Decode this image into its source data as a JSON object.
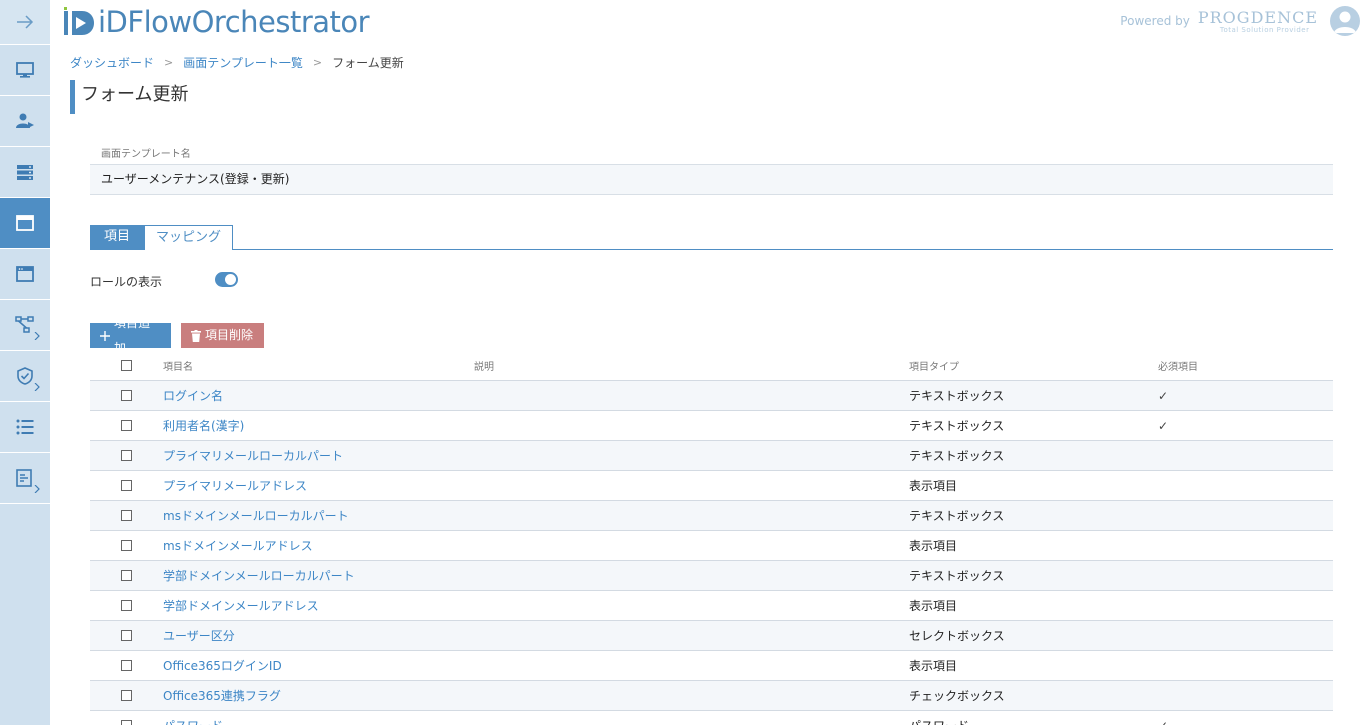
{
  "app": {
    "logo_text": "iDFlowOrchestrator",
    "powered_label": "Powered by",
    "brand_name": "PROGDENCE",
    "brand_tag": "Total Solution Provider"
  },
  "breadcrumb": {
    "items": [
      "ダッシュボード",
      "画面テンプレート一覧"
    ],
    "current": "フォーム更新"
  },
  "page": {
    "title": "フォーム更新"
  },
  "template_field": {
    "label": "画面テンプレート名",
    "value": "ユーザーメンテナンス(登録・更新)"
  },
  "tabs": [
    {
      "label": "項目",
      "active": true
    },
    {
      "label": "マッピング",
      "active": false
    }
  ],
  "role_toggle": {
    "label": "ロールの表示",
    "on": true
  },
  "actions": {
    "add_label": "項目追加",
    "delete_label": "項目削除"
  },
  "table": {
    "headers": {
      "name": "項目名",
      "description": "説明",
      "type": "項目タイプ",
      "required": "必須項目"
    },
    "rows": [
      {
        "name": "ログイン名",
        "description": "",
        "type": "テキストボックス",
        "required": "✓"
      },
      {
        "name": "利用者名(漢字)",
        "description": "",
        "type": "テキストボックス",
        "required": "✓"
      },
      {
        "name": "プライマリメールローカルパート",
        "description": "",
        "type": "テキストボックス",
        "required": ""
      },
      {
        "name": "プライマリメールアドレス",
        "description": "",
        "type": "表示項目",
        "required": ""
      },
      {
        "name": "msドメインメールローカルパート",
        "description": "",
        "type": "テキストボックス",
        "required": ""
      },
      {
        "name": "msドメインメールアドレス",
        "description": "",
        "type": "表示項目",
        "required": ""
      },
      {
        "name": "学部ドメインメールローカルパート",
        "description": "",
        "type": "テキストボックス",
        "required": ""
      },
      {
        "name": "学部ドメインメールアドレス",
        "description": "",
        "type": "表示項目",
        "required": ""
      },
      {
        "name": "ユーザー区分",
        "description": "",
        "type": "セレクトボックス",
        "required": ""
      },
      {
        "name": "Office365ログインID",
        "description": "",
        "type": "表示項目",
        "required": ""
      },
      {
        "name": "Office365連携フラグ",
        "description": "",
        "type": "チェックボックス",
        "required": ""
      },
      {
        "name": "パスワード",
        "description": "",
        "type": "パスワード",
        "required": "✓"
      }
    ]
  },
  "sidebar": {
    "items": [
      {
        "icon": "arrow-right-icon"
      },
      {
        "icon": "monitor-icon"
      },
      {
        "icon": "user-share-icon"
      },
      {
        "icon": "server-icon"
      },
      {
        "icon": "window-icon",
        "active": true
      },
      {
        "icon": "browser-icon"
      },
      {
        "icon": "workflow-icon"
      },
      {
        "icon": "shield-check-icon"
      },
      {
        "icon": "list-icon"
      },
      {
        "icon": "document-edit-icon"
      }
    ]
  },
  "colors": {
    "accent": "#4f8ec4",
    "sidebar": "#cfe0ee",
    "delete": "#c97e7e",
    "link": "#3d86c6"
  }
}
